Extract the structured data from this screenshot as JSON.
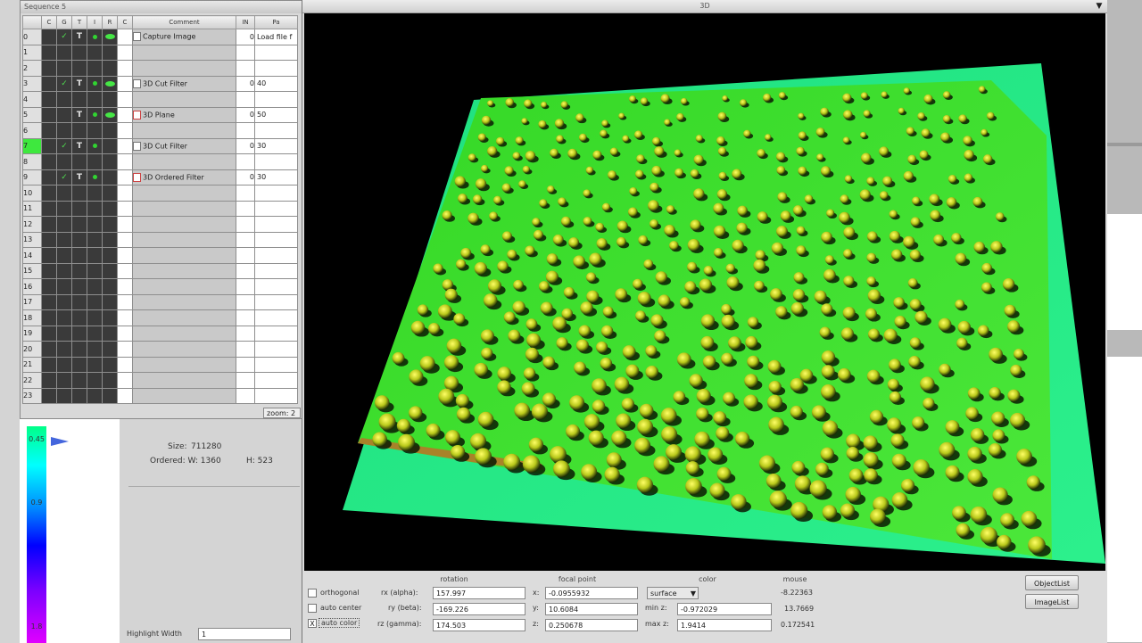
{
  "window3d": {
    "title": "3D",
    "dropdown_icon": "▼"
  },
  "sequence": {
    "title": "Sequence 5",
    "columns": [
      "",
      "C",
      "G",
      "T",
      "I",
      "R",
      "C",
      "Comment",
      "IN",
      "Pa"
    ],
    "rows": [
      {
        "idx": "0",
        "check": true,
        "t": true,
        "dot": true,
        "eye": true,
        "icon": "file",
        "comment": "Capture Image",
        "in": "0",
        "param": "Load file f"
      },
      {
        "idx": "1",
        "check": false,
        "t": false,
        "dot": false,
        "eye": false,
        "icon": "",
        "comment": "",
        "in": "",
        "param": ""
      },
      {
        "idx": "2",
        "check": false,
        "t": false,
        "dot": false,
        "eye": false,
        "icon": "",
        "comment": "",
        "in": "",
        "param": ""
      },
      {
        "idx": "3",
        "check": true,
        "t": true,
        "dot": true,
        "eye": true,
        "icon": "filter",
        "comment": "3D Cut Filter",
        "in": "0",
        "param": "40"
      },
      {
        "idx": "4",
        "check": false,
        "t": false,
        "dot": false,
        "eye": false,
        "icon": "",
        "comment": "",
        "in": "",
        "param": ""
      },
      {
        "idx": "5",
        "check": false,
        "t": true,
        "dot": true,
        "eye": true,
        "icon": "plane",
        "comment": "3D Plane",
        "in": "0",
        "param": "50"
      },
      {
        "idx": "6",
        "check": false,
        "t": false,
        "dot": false,
        "eye": false,
        "icon": "",
        "comment": "",
        "in": "",
        "param": ""
      },
      {
        "idx": "7",
        "check": true,
        "t": true,
        "dot": true,
        "eye": false,
        "icon": "filter",
        "comment": "3D Cut Filter",
        "in": "0",
        "param": "30",
        "selected": true
      },
      {
        "idx": "8",
        "check": false,
        "t": false,
        "dot": false,
        "eye": false,
        "icon": "",
        "comment": "",
        "in": "",
        "param": ""
      },
      {
        "idx": "9",
        "check": true,
        "t": true,
        "dot": true,
        "eye": false,
        "icon": "ordered",
        "comment": "3D Ordered Filter",
        "in": "0",
        "param": "30"
      },
      {
        "idx": "10"
      },
      {
        "idx": "11"
      },
      {
        "idx": "12"
      },
      {
        "idx": "13"
      },
      {
        "idx": "14"
      },
      {
        "idx": "15"
      },
      {
        "idx": "16"
      },
      {
        "idx": "17"
      },
      {
        "idx": "18"
      },
      {
        "idx": "19"
      },
      {
        "idx": "20"
      },
      {
        "idx": "21"
      },
      {
        "idx": "22"
      },
      {
        "idx": "23"
      }
    ],
    "zoom_label": "zoom: 2"
  },
  "scale": {
    "top_label": "0.45",
    "mid_label": "0.9",
    "bottom_label": "1.8"
  },
  "info": {
    "size_label": "Size:",
    "size_value": "711280",
    "ordered_label": "Ordered: W: 1360",
    "h_label": "H: 523",
    "highlight_label": "Highlight Width",
    "highlight_value": "1"
  },
  "controls": {
    "headers": {
      "rotation": "rotation",
      "focal": "focal point",
      "color": "color",
      "mouse": "mouse"
    },
    "orthogonal_label": "orthogonal",
    "auto_center_label": "auto center",
    "auto_color_label": "auto color",
    "auto_color_checked": "X",
    "rx_label": "rx (alpha):",
    "rx_value": "157.997",
    "ry_label": "ry (beta):",
    "ry_value": "-169.226",
    "rz_label": "rz (gamma):",
    "rz_value": "174.503",
    "fx_label": "x:",
    "fx_value": "-0.0955932",
    "fy_label": "y:",
    "fy_value": "10.6084",
    "fz_label": "z:",
    "fz_value": "0.250678",
    "color_mode": "surface",
    "min_label": "min z:",
    "min_value": "-0.972029",
    "max_label": "max z:",
    "max_value": "1.9414",
    "mouse_x": "-8.22363",
    "mouse_y": "13.7669",
    "mouse_z": "0.172541",
    "object_list_label": "ObjectList",
    "image_list_label": "ImageList"
  }
}
